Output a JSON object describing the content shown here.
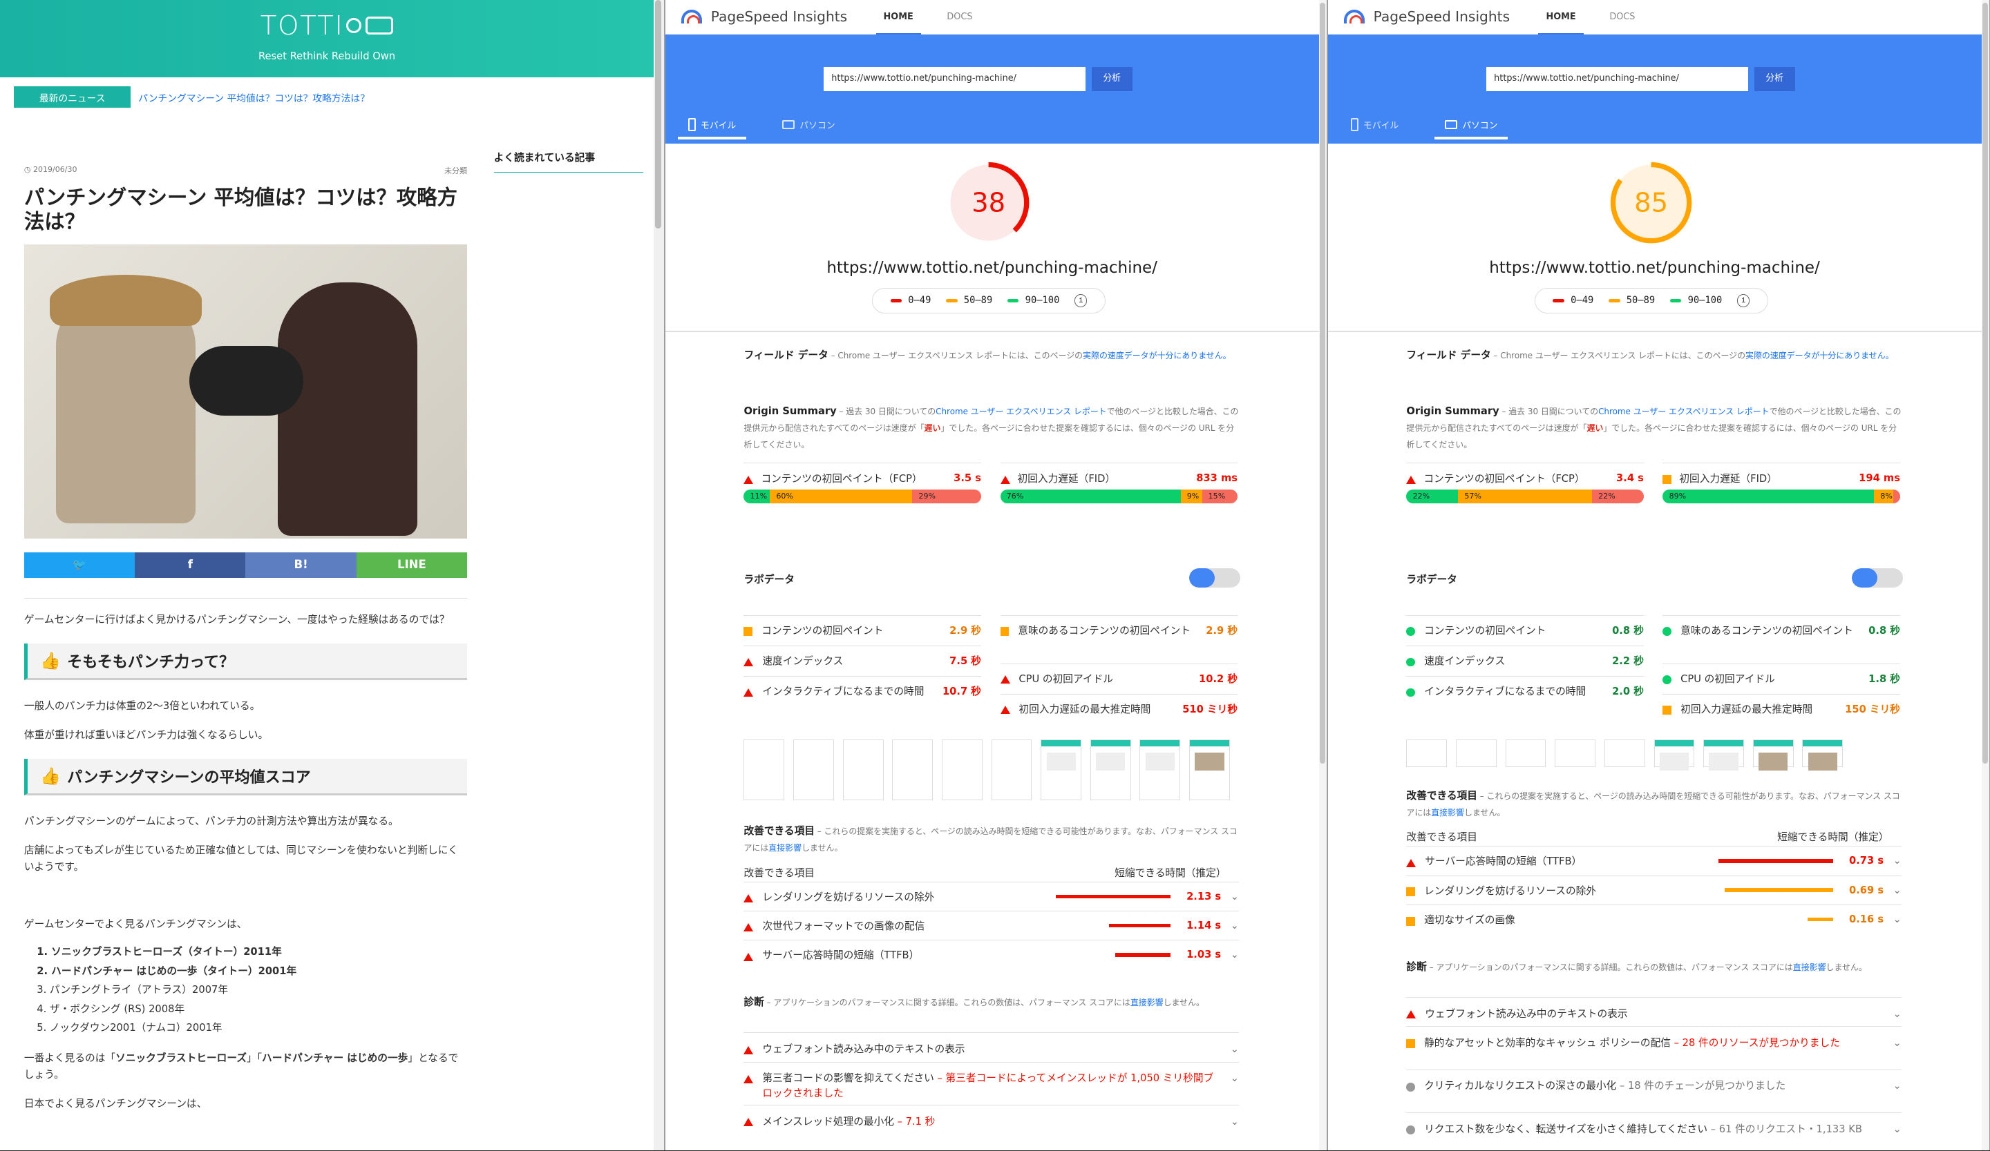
{
  "blog": {
    "logo": "TOTTI",
    "tagline": "Reset Rethink Rebuild Own",
    "news_label": "最新のニュース",
    "news_text": "パンチングマシーン 平均値は？コツは？攻略方法は？",
    "date": "2019/06/30",
    "category": "未分類",
    "title": "パンチングマシーン 平均値は？コツは？攻略方法は？",
    "share": {
      "twitter": "",
      "facebook": "f",
      "hatena": "B!",
      "line": "LINE"
    },
    "intro": "ゲームセンターに行けばよく見かけるパンチングマシーン、一度はやった経験はあるのでは？",
    "h2_1": "そもそもパンチ力って？",
    "p1": "一般人のパンチ力は体重の2〜3倍といわれている。",
    "p2": "体重が重ければ重いほどパンチ力は強くなるらしい。",
    "h2_2": "パンチングマシーンの平均値スコア",
    "p3": "パンチングマシーンのゲームによって、パンチ力の計測方法や算出方法が異なる。",
    "p4": "店舗によってもズレが生じているため正確な値としては、同じマシーンを使わないと判断しにくいようです。",
    "p5": "ゲームセンターでよく見るパンチングマシンは、",
    "list": [
      "1. ソニックブラストヒーローズ（タイトー）2011年",
      "2. ハードパンチャー はじめの一歩（タイトー）2001年",
      "3. パンチングトライ（アトラス）2007年",
      "4. ザ・ボクシング (RS) 2008年",
      "5. ノックダウン2001（ナムコ）2001年"
    ],
    "p6_a": "一番よく見るのは「",
    "p6_b": "ソニックブラストヒーローズ",
    "p6_c": "」「",
    "p6_d": "ハードパンチャー はじめの一歩",
    "p6_e": "」となるでしょう。",
    "p7": "日本でよく見るパンチングマシーンは、",
    "sidebar_title": "よく読まれている記事",
    "colors": {
      "teal": "#1ab2a2",
      "twitter": "#1da1f2",
      "facebook": "#3b5998",
      "hatena": "#5d7fc1",
      "line": "#5ab84e"
    }
  },
  "common": {
    "app_name": "PageSpeed Insights",
    "tab_home": "HOME",
    "tab_docs": "DOCS",
    "url_value": "https://www.tottio.net/punching-machine/",
    "analyze": "分析",
    "mobile": "モバイル",
    "desktop": "パソコン",
    "page_url": "https://www.tottio.net/punching-machine/",
    "legend": [
      "0–49",
      "50–89",
      "90–100"
    ],
    "field_title": "フィールド データ",
    "field_dash": " – Chrome ユーザー エクスペリエンス レポートには、このページの",
    "field_link": "実際の速度データが十分にありません。",
    "origin_title": "Origin Summary",
    "origin_a": " – 過去 30 日間についての",
    "origin_link": "Chrome ユーザー エクスペリエンス レポート",
    "origin_b": "で他のページと比較した場合、この提供元から配信されたすべてのページは速度が「",
    "origin_red": "遅い",
    "origin_c": "」でした。各ページに合わせた提案を確認するには、個々のページの URL を分析してください。",
    "fcp_label": "コンテンツの初回ペイント（FCP）",
    "fid_label": "初回入力遅延（FID）",
    "lab_title": "ラボデータ",
    "m_fcp": "コンテンツの初回ペイント",
    "m_fmp": "意味のあるコンテンツの初回ペイント",
    "m_si": "速度インデックス",
    "m_cpu": "CPU の初回アイドル",
    "m_tti": "インタラクティブになるまでの時間",
    "m_fid": "初回入力遅延の最大推定時間",
    "opp_title": "改善できる項目",
    "opp_desc": " – これらの提案を実施すると、ページの読み込み時間を短縮できる可能性があります。なお、パフォーマンス スコアには",
    "opp_link": "直接影響",
    "opp_desc2": "しません。",
    "opp_col1": "改善できる項目",
    "opp_col2": "短縮できる時間（推定）",
    "diag_title": "診断",
    "diag_desc": " – アプリケーションのパフォーマンスに関する詳細。これらの数値は、パフォーマンス スコアには",
    "diag_link": "直接影響",
    "diag_desc2": "しません。"
  },
  "mobile": {
    "score": 38,
    "fcp_value": "3.5 s",
    "fcp_dist": [
      "11%",
      "60%",
      "29%"
    ],
    "fid_value": "833 ms",
    "fid_dist": [
      "76%",
      "9%",
      "15%"
    ],
    "lab": {
      "fcp": "2.9 秒",
      "fmp": "2.9 秒",
      "si": "7.5 秒",
      "cpu": "10.2 秒",
      "tti": "10.7 秒",
      "fid": "510 ミリ秒"
    },
    "opps": [
      {
        "label": "レンダリングを妨げるリソースの除外",
        "value": "2.13 s"
      },
      {
        "label": "次世代フォーマットでの画像の配信",
        "value": "1.14 s"
      },
      {
        "label": "サーバー応答時間の短縮（TTFB）",
        "value": "1.03 s"
      }
    ],
    "diags": [
      {
        "label": "ウェブフォント読み込み中のテキストの表示",
        "sub": ""
      },
      {
        "label": "第三者コードの影響を抑えてください",
        "sub": " – 第三者コードによってメインスレッドが 1,050 ミリ秒間ブロックされました"
      },
      {
        "label": "メインスレッド処理の最小化",
        "sub": " – 7.1 秒"
      }
    ]
  },
  "desktop": {
    "score": 85,
    "fcp_value": "3.4 s",
    "fcp_dist": [
      "22%",
      "57%",
      "22%"
    ],
    "fid_value": "194 ms",
    "fid_dist": [
      "89%",
      "8%",
      "3%"
    ],
    "lab": {
      "fcp": "0.8 秒",
      "fmp": "0.8 秒",
      "si": "2.2 秒",
      "cpu": "1.8 秒",
      "tti": "2.0 秒",
      "fid": "150 ミリ秒"
    },
    "opps": [
      {
        "label": "サーバー応答時間の短縮（TTFB）",
        "value": "0.73 s"
      },
      {
        "label": "レンダリングを妨げるリソースの除外",
        "value": "0.69 s"
      },
      {
        "label": "適切なサイズの画像",
        "value": "0.16 s"
      }
    ],
    "diags": [
      {
        "label": "ウェブフォント読み込み中のテキストの表示",
        "sub": ""
      },
      {
        "label": "静的なアセットと効率的なキャッシュ ポリシーの配信",
        "sub": " – 28 件のリソースが見つかりました"
      },
      {
        "label": "クリティカルなリクエストの深さの最小化",
        "sub": " – 18 件のチェーンが見つかりました"
      },
      {
        "label": "リクエスト数を少なく、転送サイズを小さく維持してください",
        "sub": " – 61 件のリクエスト・1,133 KB"
      }
    ]
  },
  "colors": {
    "red": "#eb0f00",
    "orange": "#ffa400",
    "green": "#0cce6b",
    "blue": "#4285f4"
  }
}
